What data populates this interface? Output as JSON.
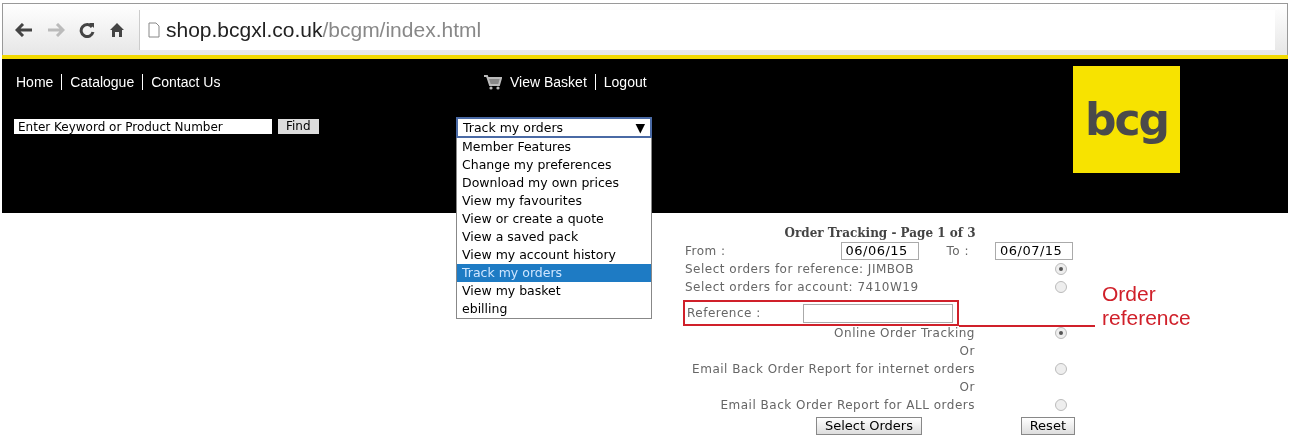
{
  "browser": {
    "url_host": "shop.bcgxl.co.uk",
    "url_path": "/bcgm/index.html"
  },
  "nav": [
    "Home",
    "Catalogue",
    "Contact Us"
  ],
  "account_links": [
    "View Basket",
    "Logout"
  ],
  "search": {
    "placeholder": "Enter Keyword or Product Number",
    "button": "Find"
  },
  "menu_select": {
    "value": "Track my orders",
    "arrow": "▼",
    "options": [
      {
        "label": "Member Features",
        "selected": false
      },
      {
        "label": "Change my preferences",
        "selected": false
      },
      {
        "label": "Download my own prices",
        "selected": false
      },
      {
        "label": "View my favourites",
        "selected": false
      },
      {
        "label": "View or create a quote",
        "selected": false
      },
      {
        "label": "View a saved pack",
        "selected": false
      },
      {
        "label": "View my account history",
        "selected": false
      },
      {
        "label": "Track my orders",
        "selected": true
      },
      {
        "label": "View my basket",
        "selected": false
      },
      {
        "label": "ebilling",
        "selected": false
      }
    ]
  },
  "logo": "bcg",
  "form": {
    "title": "Order Tracking - Page 1 of 3",
    "from_label": "From :",
    "from_value": "06/06/15",
    "to_label": "To :",
    "to_value": "06/07/15",
    "select_by": [
      {
        "label": "Select orders for reference: JIMBOB",
        "selected": true
      },
      {
        "label": "Select orders for account: 7410W19",
        "selected": false
      }
    ],
    "reference_label": "Reference :",
    "report_types": [
      {
        "label": "Online Order Tracking",
        "selected": true
      },
      {
        "label": "Email Back Order Report for internet orders",
        "selected": false
      },
      {
        "label": "Email Back Order Report for ALL orders",
        "selected": false
      }
    ],
    "separators": [
      "Or",
      "Or"
    ],
    "buttons": [
      "Select Orders",
      "Reset"
    ]
  },
  "annotation": {
    "lines": [
      "Order",
      "reference"
    ]
  }
}
